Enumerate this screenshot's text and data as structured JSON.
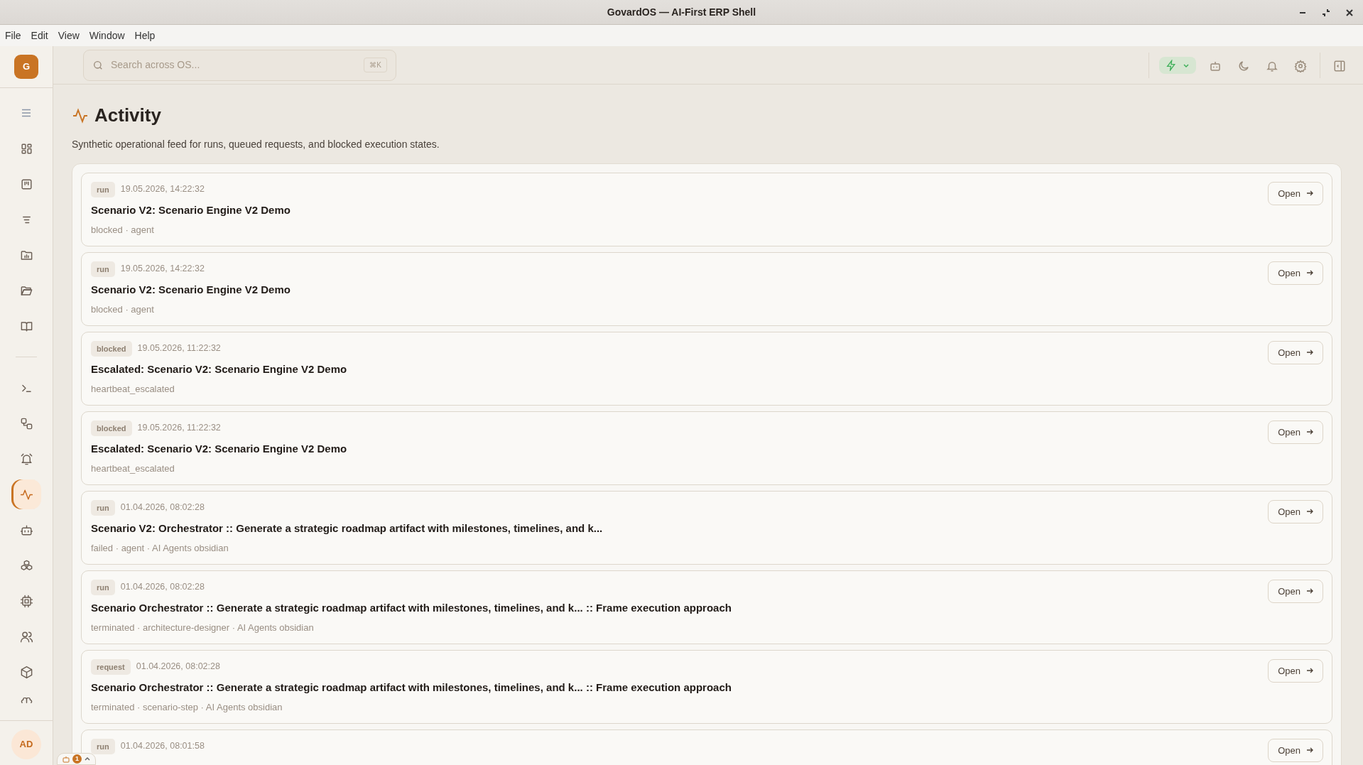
{
  "window": {
    "title": "GovardOS — AI-First ERP Shell"
  },
  "menu": [
    "File",
    "Edit",
    "View",
    "Window",
    "Help"
  ],
  "brand": {
    "letter": "G"
  },
  "search": {
    "placeholder": "Search across OS...",
    "shortcut": "⌘K"
  },
  "sidebar": {
    "items": [
      {
        "kind": "grid",
        "selected": false
      },
      {
        "kind": "board",
        "selected": false
      },
      {
        "kind": "list",
        "selected": false
      },
      {
        "kind": "folder-chart",
        "selected": false
      },
      {
        "kind": "folder",
        "selected": false
      },
      {
        "kind": "book",
        "selected": false
      }
    ],
    "tools": [
      {
        "kind": "terminal",
        "selected": false
      },
      {
        "kind": "workflow",
        "selected": false
      },
      {
        "kind": "bell",
        "selected": false
      },
      {
        "kind": "activity",
        "selected": true
      },
      {
        "kind": "bot",
        "selected": false
      },
      {
        "kind": "boxes",
        "selected": false
      },
      {
        "kind": "cpu",
        "selected": false
      },
      {
        "kind": "users",
        "selected": false
      },
      {
        "kind": "package",
        "selected": false
      },
      {
        "kind": "brain",
        "selected": false
      }
    ],
    "user": "AD"
  },
  "page": {
    "title": "Activity",
    "subtitle": "Synthetic operational feed for runs, queued requests, and blocked execution states."
  },
  "feed": [
    {
      "tag": "run",
      "time": "19.05.2026, 14:22:32",
      "title": "Scenario V2: Scenario Engine V2 Demo",
      "meta": "blocked · agent",
      "action": "Open"
    },
    {
      "tag": "run",
      "time": "19.05.2026, 14:22:32",
      "title": "Scenario V2: Scenario Engine V2 Demo",
      "meta": "blocked · agent",
      "action": "Open"
    },
    {
      "tag": "blocked",
      "time": "19.05.2026, 11:22:32",
      "title": "Escalated: Scenario V2: Scenario Engine V2 Demo",
      "meta": "heartbeat_escalated",
      "action": "Open"
    },
    {
      "tag": "blocked",
      "time": "19.05.2026, 11:22:32",
      "title": "Escalated: Scenario V2: Scenario Engine V2 Demo",
      "meta": "heartbeat_escalated",
      "action": "Open"
    },
    {
      "tag": "run",
      "time": "01.04.2026, 08:02:28",
      "title": "Scenario V2: Orchestrator :: Generate a strategic roadmap artifact with milestones, timelines, and k...",
      "meta": "failed · agent · AI Agents obsidian",
      "action": "Open"
    },
    {
      "tag": "run",
      "time": "01.04.2026, 08:02:28",
      "title": "Scenario Orchestrator :: Generate a strategic roadmap artifact with milestones, timelines, and k... :: Frame execution approach",
      "meta": "terminated · architecture-designer · AI Agents obsidian",
      "action": "Open"
    },
    {
      "tag": "request",
      "time": "01.04.2026, 08:02:28",
      "title": "Scenario Orchestrator :: Generate a strategic roadmap artifact with milestones, timelines, and k... :: Frame execution approach",
      "meta": "terminated · scenario-step · AI Agents obsidian",
      "action": "Open"
    },
    {
      "tag": "run",
      "time": "01.04.2026, 08:01:58",
      "action": "Open"
    }
  ],
  "agent_widget": {
    "count": "1"
  }
}
